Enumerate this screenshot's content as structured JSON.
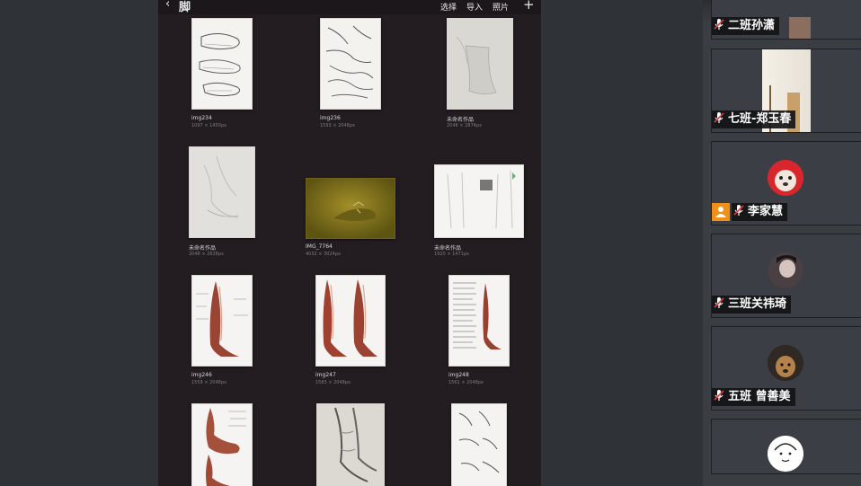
{
  "shared_screen": {
    "title": "脚",
    "toolbar": {
      "select_label": "选择",
      "import_label": "导入",
      "photos_label": "照片",
      "add_label": "+"
    },
    "files": [
      {
        "name": "img234",
        "meta": "1097 × 1450px"
      },
      {
        "name": "img236",
        "meta": "1593 × 2048px"
      },
      {
        "name": "未命名作品",
        "meta": "2048 × 2874px"
      },
      {
        "name": "未命名作品",
        "meta": "2048 × 2828px"
      },
      {
        "name": "IMG_7764",
        "meta": "4032 × 3024px"
      },
      {
        "name": "未命名作品",
        "meta": "1920 × 1471px"
      },
      {
        "name": "img246",
        "meta": "1559 × 2048px"
      },
      {
        "name": "img247",
        "meta": "1583 × 2048px"
      },
      {
        "name": "img248",
        "meta": "1561 × 2048px"
      },
      {
        "name": "",
        "meta": ""
      },
      {
        "name": "",
        "meta": ""
      },
      {
        "name": "",
        "meta": ""
      }
    ]
  },
  "participants": [
    {
      "name": "二班孙潇"
    },
    {
      "name": "七班-郑玉春"
    },
    {
      "name": "李家慧"
    },
    {
      "name": "三班关祎琦"
    },
    {
      "name": "五班 曾善美"
    },
    {
      "name": ""
    }
  ],
  "colors": {
    "share_bg": "#231d21",
    "panel_bg": "#3a3d42",
    "host_badge": "#f0901a",
    "mic_muted": "#e23b3b"
  }
}
